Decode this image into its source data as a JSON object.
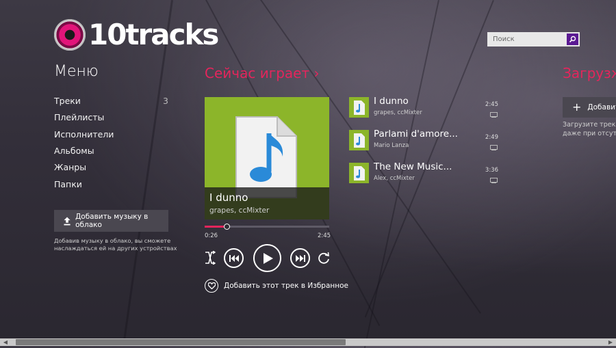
{
  "app": {
    "logo_text": "10tracks"
  },
  "search": {
    "placeholder": "Поиск"
  },
  "menu": {
    "title": "Меню",
    "items": [
      {
        "label": "Треки",
        "count": "3"
      },
      {
        "label": "Плейлисты",
        "count": ""
      },
      {
        "label": "Исполнители",
        "count": ""
      },
      {
        "label": "Альбомы",
        "count": ""
      },
      {
        "label": "Жанры",
        "count": ""
      },
      {
        "label": "Папки",
        "count": ""
      }
    ],
    "add_cloud_label": "Добавить музыку в облако",
    "cloud_note": "Добавив музыку в облако, вы сможете наслаждаться ей на других устройствах"
  },
  "now_playing": {
    "title": "Сейчас играет ›",
    "track": "I dunno",
    "artist": "grapes, ccMixter",
    "current_time": "0:26",
    "total_time": "2:45",
    "progress_fraction": 0.17,
    "favorite_label": "Добавить этот трек в Избранное"
  },
  "tracks": [
    {
      "name": "I dunno",
      "artist": "grapes, ccMixter",
      "duration": "2:45"
    },
    {
      "name": "Parlami d'amore...",
      "artist": "Mario Lanza",
      "duration": "2:49"
    },
    {
      "name": "The New Music...",
      "artist": "Alex, ccMixter",
      "duration": "3:36"
    }
  ],
  "upload": {
    "title": "Загрузже",
    "add_label": "Добавит",
    "note_line1": "Загрузите треки",
    "note_line2": "даже при отсутс"
  },
  "colors": {
    "accent": "#e5255c",
    "album_green": "#8cb52a",
    "search_button": "#5b1a93"
  }
}
